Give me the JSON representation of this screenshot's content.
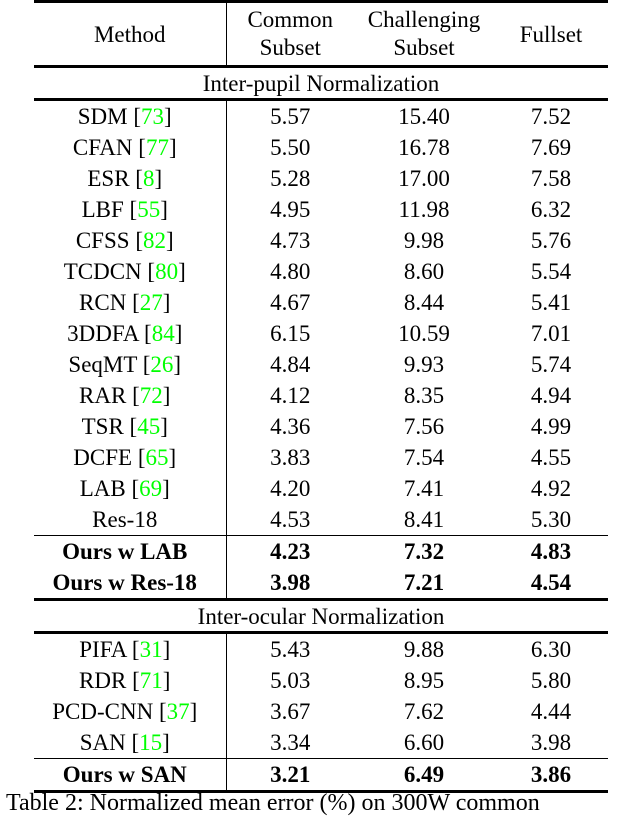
{
  "table": {
    "columns": [
      {
        "label": "Method",
        "lines": [
          "Method"
        ]
      },
      {
        "label": "Common Subset",
        "lines": [
          "Common",
          "Subset"
        ]
      },
      {
        "label": "Challenging Subset",
        "lines": [
          "Challenging",
          "Subset"
        ]
      },
      {
        "label": "Fullset",
        "lines": [
          "Fullset"
        ]
      }
    ],
    "header": {
      "method": "Method",
      "common_line1": "Common",
      "common_line2": "Subset",
      "challenging_line1": "Challenging",
      "challenging_line2": "Subset",
      "fullset": "Fullset"
    },
    "sections": [
      {
        "title": "Inter-pupil Normalization",
        "rows": [
          {
            "method": "SDM",
            "ref": "73",
            "common": "5.57",
            "challenging": "15.40",
            "fullset": "7.52",
            "bold": false
          },
          {
            "method": "CFAN",
            "ref": "77",
            "common": "5.50",
            "challenging": "16.78",
            "fullset": "7.69",
            "bold": false
          },
          {
            "method": "ESR",
            "ref": "8",
            "common": "5.28",
            "challenging": "17.00",
            "fullset": "7.58",
            "bold": false
          },
          {
            "method": "LBF",
            "ref": "55",
            "common": "4.95",
            "challenging": "11.98",
            "fullset": "6.32",
            "bold": false
          },
          {
            "method": "CFSS",
            "ref": "82",
            "common": "4.73",
            "challenging": "9.98",
            "fullset": "5.76",
            "bold": false
          },
          {
            "method": "TCDCN",
            "ref": "80",
            "common": "4.80",
            "challenging": "8.60",
            "fullset": "5.54",
            "bold": false
          },
          {
            "method": "RCN",
            "ref": "27",
            "common": "4.67",
            "challenging": "8.44",
            "fullset": "5.41",
            "bold": false
          },
          {
            "method": "3DDFA",
            "ref": "84",
            "common": "6.15",
            "challenging": "10.59",
            "fullset": "7.01",
            "bold": false
          },
          {
            "method": "SeqMT",
            "ref": "26",
            "common": "4.84",
            "challenging": "9.93",
            "fullset": "5.74",
            "bold": false
          },
          {
            "method": "RAR",
            "ref": "72",
            "common": "4.12",
            "challenging": "8.35",
            "fullset": "4.94",
            "bold": false
          },
          {
            "method": "TSR",
            "ref": "45",
            "common": "4.36",
            "challenging": "7.56",
            "fullset": "4.99",
            "bold": false
          },
          {
            "method": "DCFE",
            "ref": "65",
            "common": "3.83",
            "challenging": "7.54",
            "fullset": "4.55",
            "bold": false
          },
          {
            "method": "LAB ",
            "ref": "69",
            "common": "4.20",
            "challenging": "7.41",
            "fullset": "4.92",
            "bold": false
          },
          {
            "method": "Res-18",
            "ref": "",
            "common": "4.53",
            "challenging": "8.41",
            "fullset": "5.30",
            "bold": false
          }
        ],
        "ours_rows": [
          {
            "method": "Ours w LAB",
            "ref": "",
            "common": "4.23",
            "challenging": "7.32",
            "fullset": "4.83",
            "bold": true
          },
          {
            "method": "Ours w Res-18",
            "ref": "",
            "common": "3.98",
            "challenging": "7.21",
            "fullset": "4.54",
            "bold": true
          }
        ]
      },
      {
        "title": "Inter-ocular Normalization",
        "rows": [
          {
            "method": "PIFA",
            "ref": "31",
            "common": "5.43",
            "challenging": "9.88",
            "fullset": "6.30",
            "bold": false
          },
          {
            "method": "RDR",
            "ref": "71",
            "common": "5.03",
            "challenging": "8.95",
            "fullset": "5.80",
            "bold": false
          },
          {
            "method": "PCD-CNN",
            "ref": "37",
            "common": "3.67",
            "challenging": "7.62",
            "fullset": "4.44",
            "bold": false
          },
          {
            "method": "SAN",
            "ref": "15",
            "common": "3.34",
            "challenging": "6.60",
            "fullset": "3.98",
            "bold": false
          }
        ],
        "ours_rows": [
          {
            "method": "Ours w SAN",
            "ref": "",
            "common": "3.21",
            "challenging": "6.49",
            "fullset": "3.86",
            "bold": true
          }
        ]
      }
    ]
  },
  "caption": {
    "text": "Table 2:   Normalized mean error (%) on 300W common"
  },
  "colors": {
    "reference_green": "#00ff00",
    "text": "#000000",
    "background": "#ffffff",
    "rule": "#000000"
  }
}
